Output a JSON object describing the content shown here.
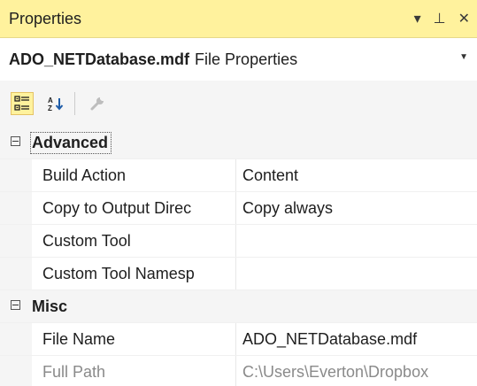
{
  "panel": {
    "title": "Properties",
    "controls": {
      "dropdown": "▾",
      "pin": "⊥",
      "close": "✕"
    }
  },
  "object": {
    "name": "ADO_NETDatabase.mdf",
    "type": "File Properties"
  },
  "toolbar": {
    "buttons": [
      "categorized",
      "alphabetical",
      "property-pages"
    ]
  },
  "grid": {
    "categories": [
      {
        "name": "Advanced",
        "properties": [
          {
            "name": "Build Action",
            "value": "Content"
          },
          {
            "name": "Copy to Output Direc",
            "value": "Copy always"
          },
          {
            "name": "Custom Tool",
            "value": ""
          },
          {
            "name": "Custom Tool Namesp",
            "value": ""
          }
        ]
      },
      {
        "name": "Misc",
        "properties": [
          {
            "name": "File Name",
            "value": "ADO_NETDatabase.mdf"
          },
          {
            "name": "Full Path",
            "value": "C:\\Users\\Everton\\Dropbox"
          }
        ]
      }
    ]
  },
  "colors": {
    "accent": "#fff29d",
    "accent_border": "#e5c365",
    "readonly_text": "#8a8a8a"
  }
}
